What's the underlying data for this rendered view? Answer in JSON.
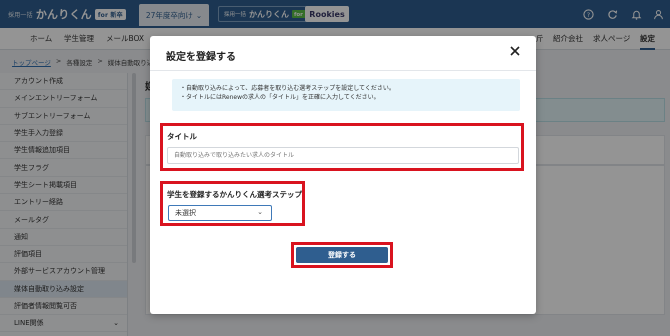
{
  "header": {
    "logo_small": "採用一括",
    "logo_main": "かんりくん",
    "logo_badge": "for 新卒",
    "year_select": "27年度卒向け",
    "logo2_small": "採用一括",
    "logo2_main": "かんりくん",
    "logo2_tag": "for 中途",
    "logo3": "Rookies",
    "icons": [
      "help-icon",
      "refresh-icon",
      "bell-icon",
      "user-icon"
    ]
  },
  "nav": {
    "items": [
      "ホーム",
      "学生管理",
      "メールBOX",
      "斤",
      "紹介会社",
      "求人ページ",
      "設定"
    ],
    "active": "設定"
  },
  "breadcrumb": {
    "top": "トップページ",
    "sep": ">",
    "level2": "各種設定",
    "level3": "媒体自動取り込み"
  },
  "sidebar": {
    "items": [
      "アカウント作成",
      "メインエントリーフォーム",
      "サブエントリーフォーム",
      "学生手入力登録",
      "学生情報追加項目",
      "学生フラグ",
      "学生シート掲載項目",
      "エントリー経路",
      "メールタグ",
      "通知",
      "評価項目",
      "外部サービスアカウント管理",
      "媒体自動取り込み設定",
      "評価者情報閲覧可否",
      "LINE関係"
    ],
    "active_index": 12
  },
  "background": {
    "title": "媒"
  },
  "modal": {
    "title": "設定を登録する",
    "notice_lines": [
      "・自動取り込みによって、応募者を取り込む選考ステップを設定してください。",
      "・タイトルにはRenewの求人の「タイトル」を正確に入力してください。"
    ],
    "title_label": "タイトル",
    "title_placeholder": "自動取り込みで取り込みたい求人のタイトル",
    "step_label": "学生を登録するかんりくん選考ステップ",
    "step_value": "未選択",
    "submit_label": "登録する"
  },
  "colors": {
    "brand": "#2f5e8f",
    "highlight": "#d9131f",
    "notice_bg": "#e6f4fa"
  }
}
